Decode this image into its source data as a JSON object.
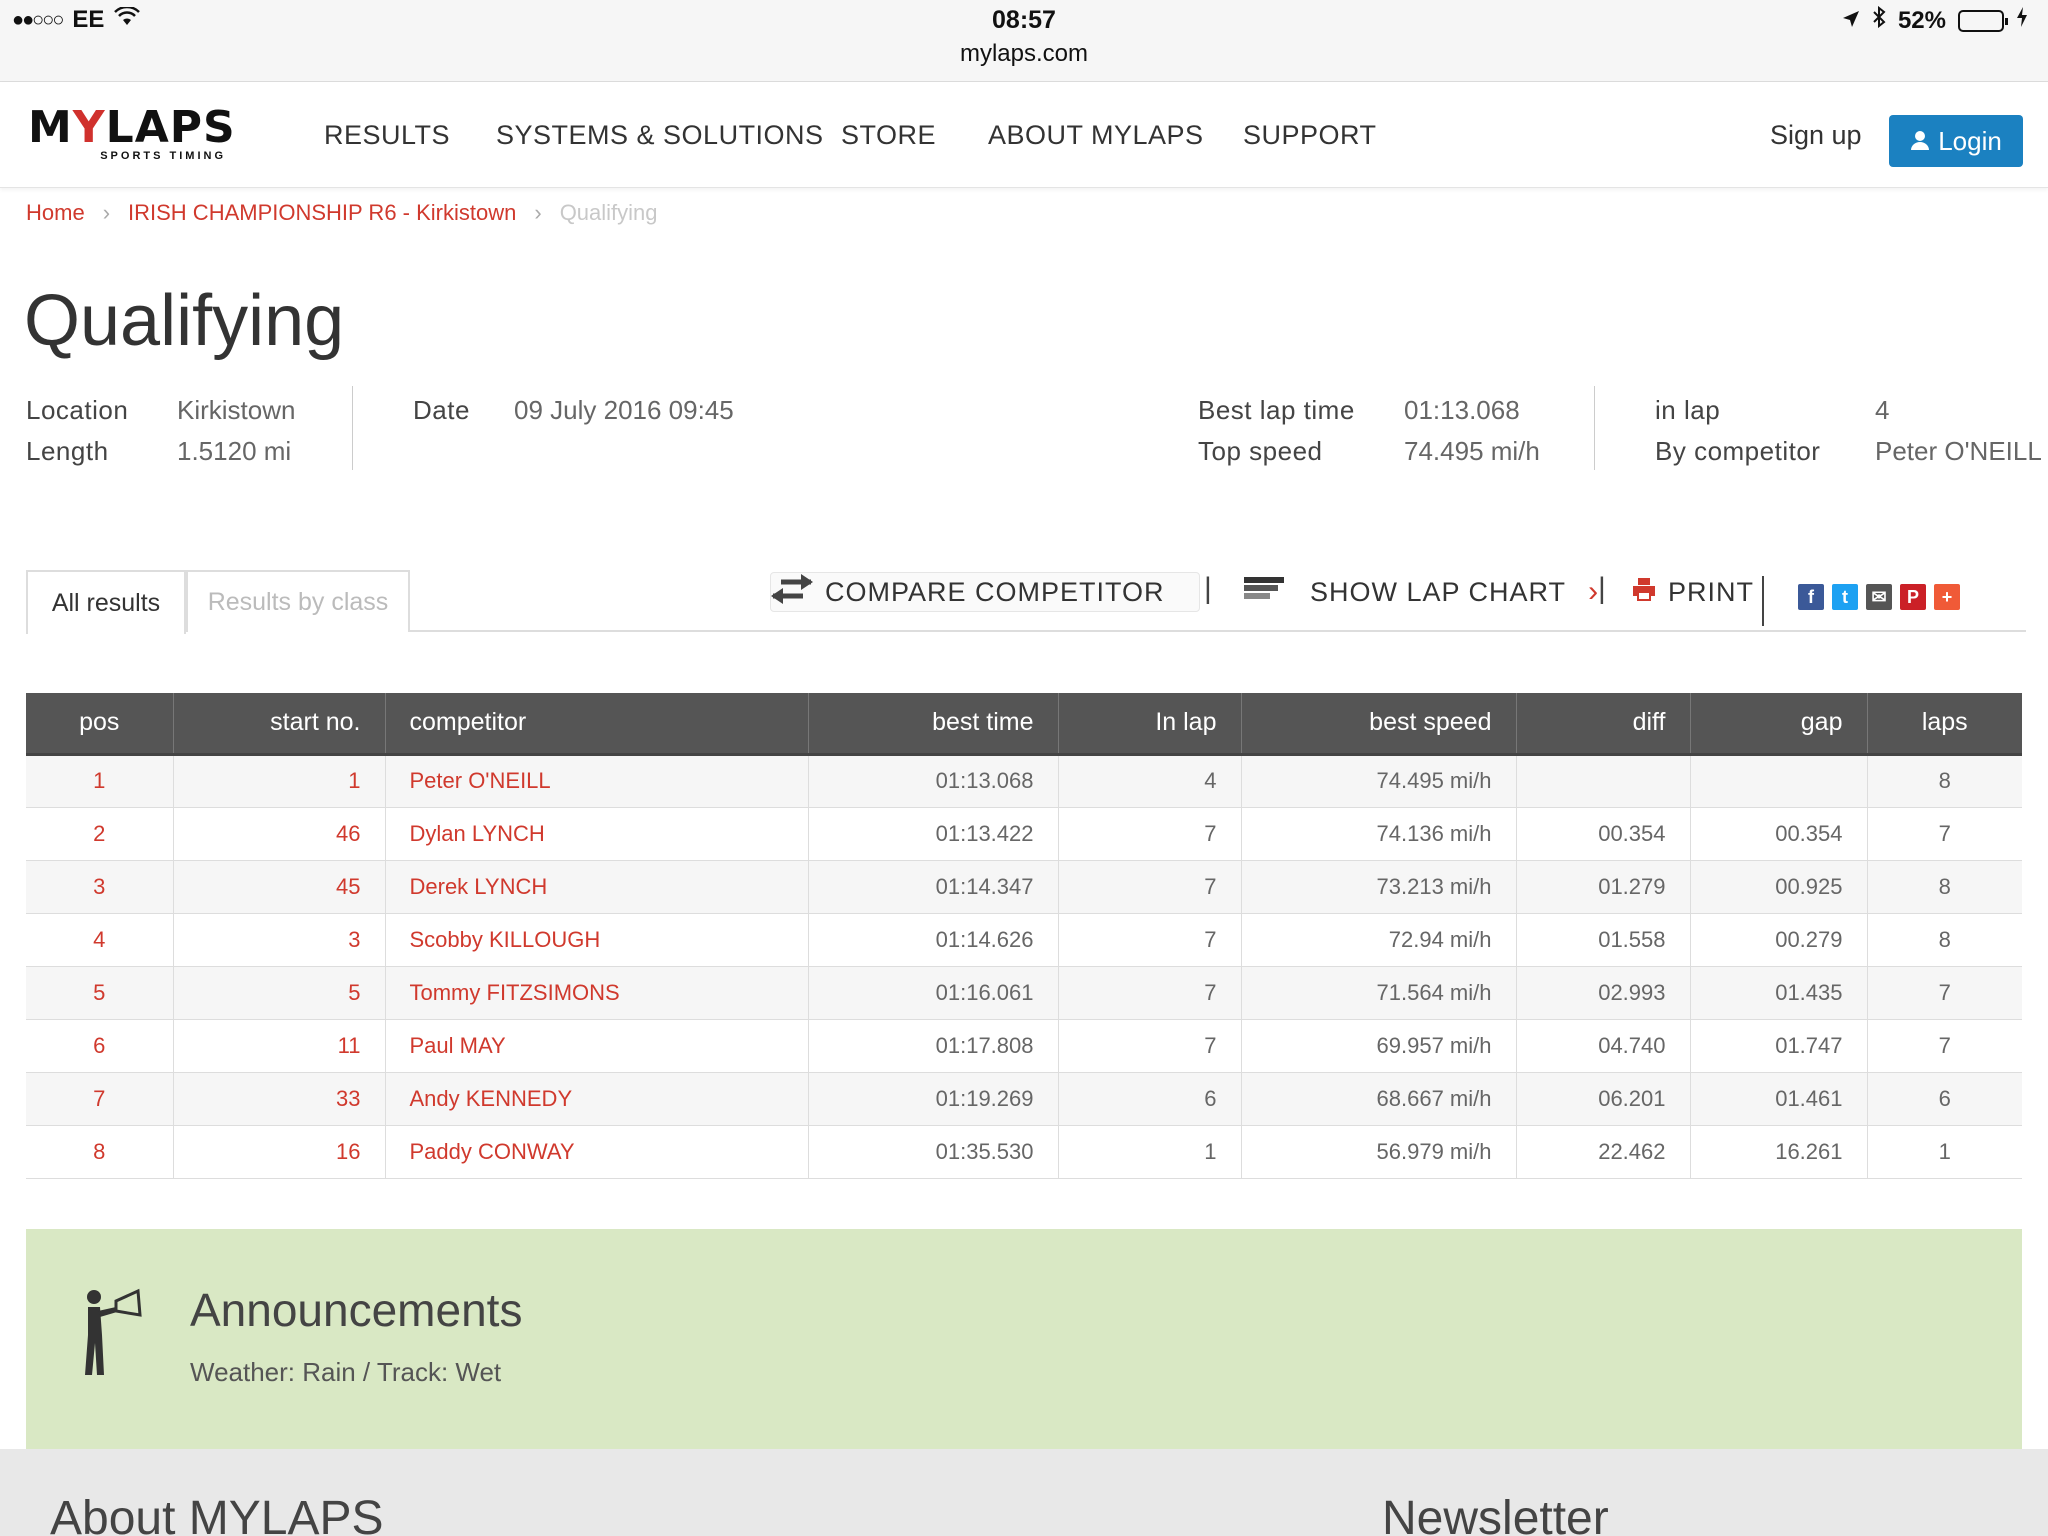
{
  "status_bar": {
    "signal": "●●○○○",
    "carrier": "EE",
    "time": "08:57",
    "url": "mylaps.com",
    "battery": "52%",
    "battery_level": 0.52
  },
  "nav": {
    "logo_main_a": "M",
    "logo_main_accent": "Y",
    "logo_main_b": "LAPS",
    "logo_sub": "SPORTS TIMING",
    "items": [
      "RESULTS",
      "SYSTEMS & SOLUTIONS",
      "STORE",
      "ABOUT MYLAPS",
      "SUPPORT"
    ],
    "signup": "Sign up",
    "login": "Login"
  },
  "breadcrumb": {
    "home": "Home",
    "event": "IRISH CHAMPIONSHIP R6 - Kirkistown",
    "current": "Qualifying"
  },
  "page_title": "Qualifying",
  "info": {
    "location_label": "Location",
    "location_value": "Kirkistown",
    "length_label": "Length",
    "length_value": "1.5120 mi",
    "date_label": "Date",
    "date_value": "09 July 2016 09:45",
    "best_lap_label": "Best lap time",
    "best_lap_value": "01:13.068",
    "top_speed_label": "Top speed",
    "top_speed_value": "74.495 mi/h",
    "in_lap_label": "in lap",
    "in_lap_value": "4",
    "by_competitor_label": "By competitor",
    "by_competitor_value": "Peter O'NEILL"
  },
  "tabs": {
    "all_results": "All results",
    "results_by_class": "Results by class"
  },
  "toolbar": {
    "compare": "COMPARE COMPETITOR",
    "lap_chart": "SHOW LAP CHART",
    "print": "PRINT",
    "separator": "|"
  },
  "social": [
    "f",
    "t",
    "✉",
    "P",
    "+"
  ],
  "table": {
    "headers": [
      "pos",
      "start no.",
      "competitor",
      "best time",
      "In lap",
      "best speed",
      "diff",
      "gap",
      "laps"
    ],
    "rows": [
      [
        "1",
        "1",
        "Peter O'NEILL",
        "01:13.068",
        "4",
        "74.495 mi/h",
        "",
        "",
        "8"
      ],
      [
        "2",
        "46",
        "Dylan LYNCH",
        "01:13.422",
        "7",
        "74.136 mi/h",
        "00.354",
        "00.354",
        "7"
      ],
      [
        "3",
        "45",
        "Derek LYNCH",
        "01:14.347",
        "7",
        "73.213 mi/h",
        "01.279",
        "00.925",
        "8"
      ],
      [
        "4",
        "3",
        "Scobby KILLOUGH",
        "01:14.626",
        "7",
        "72.94 mi/h",
        "01.558",
        "00.279",
        "8"
      ],
      [
        "5",
        "5",
        "Tommy FITZSIMONS",
        "01:16.061",
        "7",
        "71.564 mi/h",
        "02.993",
        "01.435",
        "7"
      ],
      [
        "6",
        "11",
        "Paul MAY",
        "01:17.808",
        "7",
        "69.957 mi/h",
        "04.740",
        "01.747",
        "7"
      ],
      [
        "7",
        "33",
        "Andy KENNEDY",
        "01:19.269",
        "6",
        "68.667 mi/h",
        "06.201",
        "01.461",
        "6"
      ],
      [
        "8",
        "16",
        "Paddy CONWAY",
        "01:35.530",
        "1",
        "56.979 mi/h",
        "22.462",
        "16.261",
        "1"
      ]
    ]
  },
  "announcements": {
    "title": "Announcements",
    "text": "Weather: Rain / Track: Wet"
  },
  "footer": {
    "about": "About MYLAPS",
    "newsletter": "Newsletter"
  },
  "colors": {
    "accent_red": "#d0392d",
    "login_blue": "#1b81c1",
    "table_header": "#555555",
    "announce_green": "#d9e8c4"
  }
}
